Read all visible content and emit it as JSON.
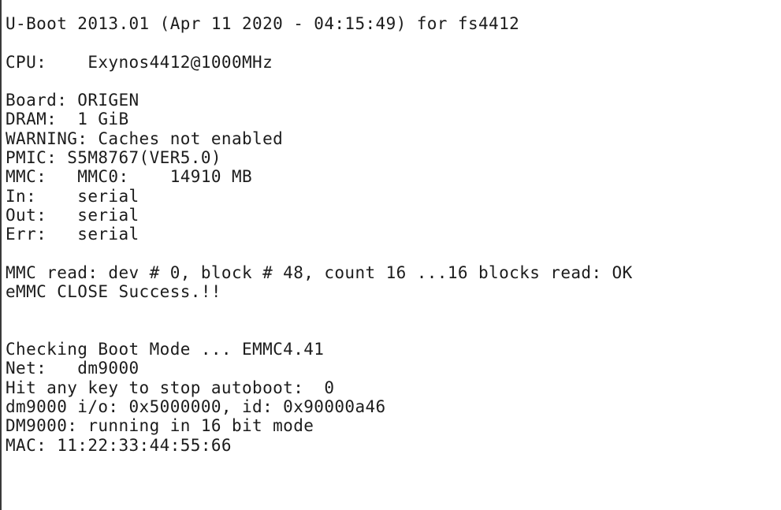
{
  "terminal": {
    "lines": [
      "U-Boot 2013.01 (Apr 11 2020 - 04:15:49) for fs4412",
      "",
      "CPU:    Exynos4412@1000MHz",
      "",
      "Board: ORIGEN",
      "DRAM:  1 GiB",
      "WARNING: Caches not enabled",
      "PMIC: S5M8767(VER5.0)",
      "MMC:   MMC0:    14910 MB",
      "In:    serial",
      "Out:   serial",
      "Err:   serial",
      "",
      "MMC read: dev # 0, block # 48, count 16 ...16 blocks read: OK",
      "eMMC CLOSE Success.!!",
      "",
      "",
      "Checking Boot Mode ... EMMC4.41",
      "Net:   dm9000",
      "Hit any key to stop autoboot:  0",
      "dm9000 i/o: 0x5000000, id: 0x90000a46",
      "DM9000: running in 16 bit mode",
      "MAC: 11:22:33:44:55:66"
    ]
  }
}
